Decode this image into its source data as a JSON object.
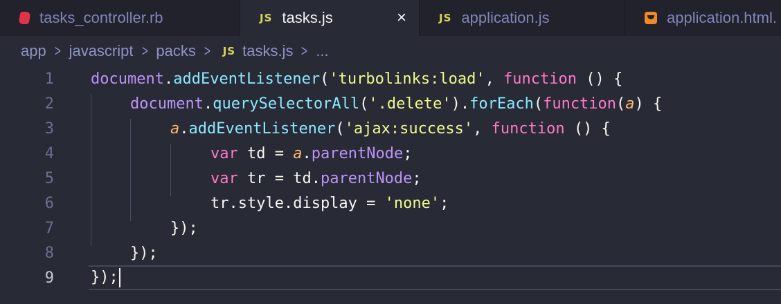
{
  "tabs": [
    {
      "label": "tasks_controller.rb",
      "icon": "ruby-file-icon",
      "active": false
    },
    {
      "label": "tasks.js",
      "icon": "js-file-icon",
      "active": true,
      "close_glyph": "×"
    },
    {
      "label": "application.js",
      "icon": "js-file-icon",
      "active": false
    },
    {
      "label": "application.html.",
      "icon": "html-file-icon",
      "active": false
    }
  ],
  "icons": {
    "js_badge": "JS"
  },
  "breadcrumb": {
    "items": [
      "app",
      "javascript",
      "packs",
      "tasks.js",
      "..."
    ],
    "separator": ">"
  },
  "editor": {
    "active_line": 9,
    "lines": [
      {
        "number": "1"
      },
      {
        "number": "2"
      },
      {
        "number": "3"
      },
      {
        "number": "4"
      },
      {
        "number": "5"
      },
      {
        "number": "6"
      },
      {
        "number": "7"
      },
      {
        "number": "8"
      },
      {
        "number": "9"
      }
    ],
    "tokens": {
      "l1": [
        "document",
        ".",
        "addEventListener",
        "(",
        "'turbolinks:load'",
        ", ",
        "function",
        " () {"
      ],
      "l2": [
        "document",
        ".",
        "querySelectorAll",
        "(",
        "'.delete'",
        ").",
        "forEach",
        "(",
        "function",
        "(",
        "a",
        ") {"
      ],
      "l3": [
        "a",
        ".",
        "addEventListener",
        "(",
        "'ajax:success'",
        ", ",
        "function",
        " () {"
      ],
      "l4": [
        "var",
        " td = ",
        "a",
        ".",
        "parentNode",
        ";"
      ],
      "l5": [
        "var",
        " tr = td.",
        "parentNode",
        ";"
      ],
      "l6": [
        "tr.style.display = ",
        "'none'",
        ";"
      ],
      "l7": [
        "});"
      ],
      "l8": [
        "});"
      ],
      "l9": [
        "});"
      ]
    }
  },
  "colors": {
    "background": "#282a36",
    "tabbar": "#21222c",
    "string": "#f1fa8c",
    "keyword": "#ff79c6",
    "method": "#8be9fd",
    "object": "#bd93f9",
    "parameter": "#ffb86c"
  }
}
